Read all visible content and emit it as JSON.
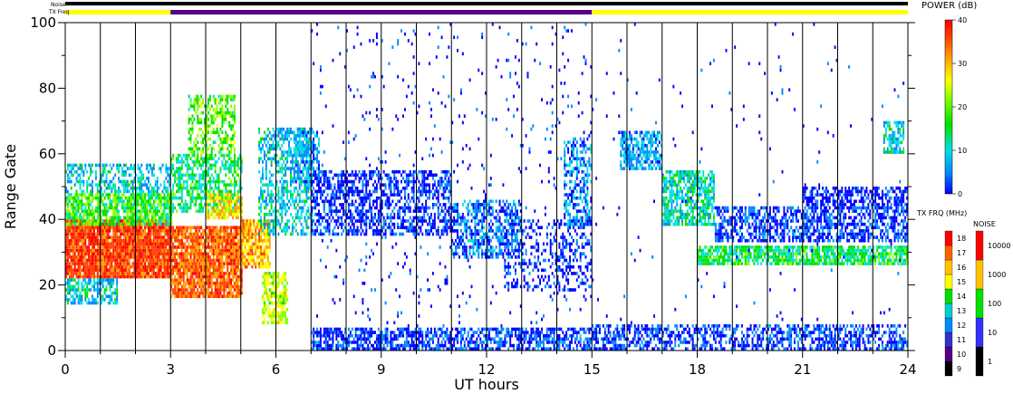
{
  "chart_data": {
    "type": "heatmap",
    "xlabel": "UT hours",
    "ylabel": "Range Gate",
    "xlim": [
      0,
      24
    ],
    "ylim": [
      0,
      100
    ],
    "x_ticks": [
      "0",
      "3",
      "6",
      "9",
      "12",
      "15",
      "18",
      "21",
      "24"
    ],
    "y_ticks": [
      "0",
      "20",
      "40",
      "60",
      "80",
      "100"
    ],
    "grid": "vertical lines every 1 UT hour",
    "noise_bar_label": "Noise",
    "txfreq_bar_label": "TX Freq",
    "txfreq_segments": [
      {
        "start": 0,
        "end": 3,
        "color": "#ffff00"
      },
      {
        "start": 3,
        "end": 15,
        "color": "#550088"
      },
      {
        "start": 15,
        "end": 24,
        "color": "#ffff00"
      }
    ],
    "power_colorbar": {
      "title": "POWER (dB)",
      "ticks": [
        "0",
        "10",
        "20",
        "30",
        "40"
      ],
      "range": [
        0,
        40
      ],
      "colors": [
        "#0000ff",
        "#0088ff",
        "#00e0e0",
        "#00e000",
        "#88ff00",
        "#ffff00",
        "#ffa000",
        "#ff4000",
        "#ff0000"
      ]
    },
    "txfreq_colorbar": {
      "title": "TX FRQ (MHz)",
      "ticks": [
        "9",
        "10",
        "11",
        "12",
        "13",
        "14",
        "15",
        "16",
        "17",
        "18"
      ],
      "colors": [
        "#000000",
        "#550088",
        "#3333cc",
        "#0088ff",
        "#00cccc",
        "#00e000",
        "#ffff00",
        "#ffc000",
        "#ff6000",
        "#ff0000"
      ]
    },
    "noise_colorbar": {
      "title": "NOISE",
      "ticks": [
        "1",
        "10",
        "100",
        "1000",
        "10000"
      ],
      "colors": [
        "#000000",
        "#3333ff",
        "#00e000",
        "#ffc000",
        "#ff0000"
      ]
    },
    "echo_regions": [
      {
        "x0": 0.0,
        "x1": 3.0,
        "y0": 22,
        "y1": 40,
        "level": 34,
        "density": 0.95
      },
      {
        "x0": 0.0,
        "x1": 3.0,
        "y0": 38,
        "y1": 48,
        "level": 16,
        "density": 0.8
      },
      {
        "x0": 0.0,
        "x1": 3.0,
        "y0": 48,
        "y1": 57,
        "level": 10,
        "density": 0.5
      },
      {
        "x0": 0.0,
        "x1": 1.5,
        "y0": 14,
        "y1": 22,
        "level": 10,
        "density": 0.6
      },
      {
        "x0": 3.0,
        "x1": 5.0,
        "y0": 16,
        "y1": 38,
        "level": 32,
        "density": 0.9
      },
      {
        "x0": 5.0,
        "x1": 5.8,
        "y0": 25,
        "y1": 40,
        "level": 28,
        "density": 0.8
      },
      {
        "x0": 3.0,
        "x1": 5.0,
        "y0": 42,
        "y1": 60,
        "level": 14,
        "density": 0.6
      },
      {
        "x0": 3.5,
        "x1": 4.8,
        "y0": 60,
        "y1": 78,
        "level": 18,
        "density": 0.5
      },
      {
        "x0": 4.0,
        "x1": 5.0,
        "y0": 40,
        "y1": 48,
        "level": 26,
        "density": 0.7
      },
      {
        "x0": 5.6,
        "x1": 6.3,
        "y0": 8,
        "y1": 24,
        "level": 22,
        "density": 0.7
      },
      {
        "x0": 5.5,
        "x1": 7.0,
        "y0": 35,
        "y1": 68,
        "level": 10,
        "density": 0.5
      },
      {
        "x0": 6.5,
        "x1": 7.2,
        "y0": 50,
        "y1": 68,
        "level": 8,
        "density": 0.55
      },
      {
        "x0": 7.0,
        "x1": 11.0,
        "y0": 35,
        "y1": 55,
        "level": 3,
        "density": 0.55
      },
      {
        "x0": 11.0,
        "x1": 13.0,
        "y0": 28,
        "y1": 46,
        "level": 6,
        "density": 0.55
      },
      {
        "x0": 12.5,
        "x1": 15.0,
        "y0": 18,
        "y1": 40,
        "level": 3,
        "density": 0.3
      },
      {
        "x0": 14.2,
        "x1": 15.0,
        "y0": 38,
        "y1": 65,
        "level": 7,
        "density": 0.5
      },
      {
        "x0": 7.0,
        "x1": 15.0,
        "y0": 0,
        "y1": 7,
        "level": 4,
        "density": 0.65
      },
      {
        "x0": 15.0,
        "x1": 24.0,
        "y0": 0,
        "y1": 8,
        "level": 4,
        "density": 0.55
      },
      {
        "x0": 15.8,
        "x1": 17.0,
        "y0": 55,
        "y1": 67,
        "level": 8,
        "density": 0.7
      },
      {
        "x0": 17.0,
        "x1": 18.5,
        "y0": 38,
        "y1": 55,
        "level": 12,
        "density": 0.7
      },
      {
        "x0": 18.0,
        "x1": 24.0,
        "y0": 26,
        "y1": 32,
        "level": 14,
        "density": 0.8
      },
      {
        "x0": 18.5,
        "x1": 24.0,
        "y0": 33,
        "y1": 44,
        "level": 4,
        "density": 0.6
      },
      {
        "x0": 21.0,
        "x1": 24.0,
        "y0": 44,
        "y1": 50,
        "level": 2,
        "density": 0.6
      },
      {
        "x0": 23.3,
        "x1": 23.9,
        "y0": 60,
        "y1": 70,
        "level": 10,
        "density": 0.6
      },
      {
        "x0": 7.0,
        "x1": 15.0,
        "y0": 5,
        "y1": 100,
        "level": 2,
        "density": 0.03
      },
      {
        "x0": 15.0,
        "x1": 24.0,
        "y0": 8,
        "y1": 100,
        "level": 2,
        "density": 0.01
      }
    ]
  }
}
